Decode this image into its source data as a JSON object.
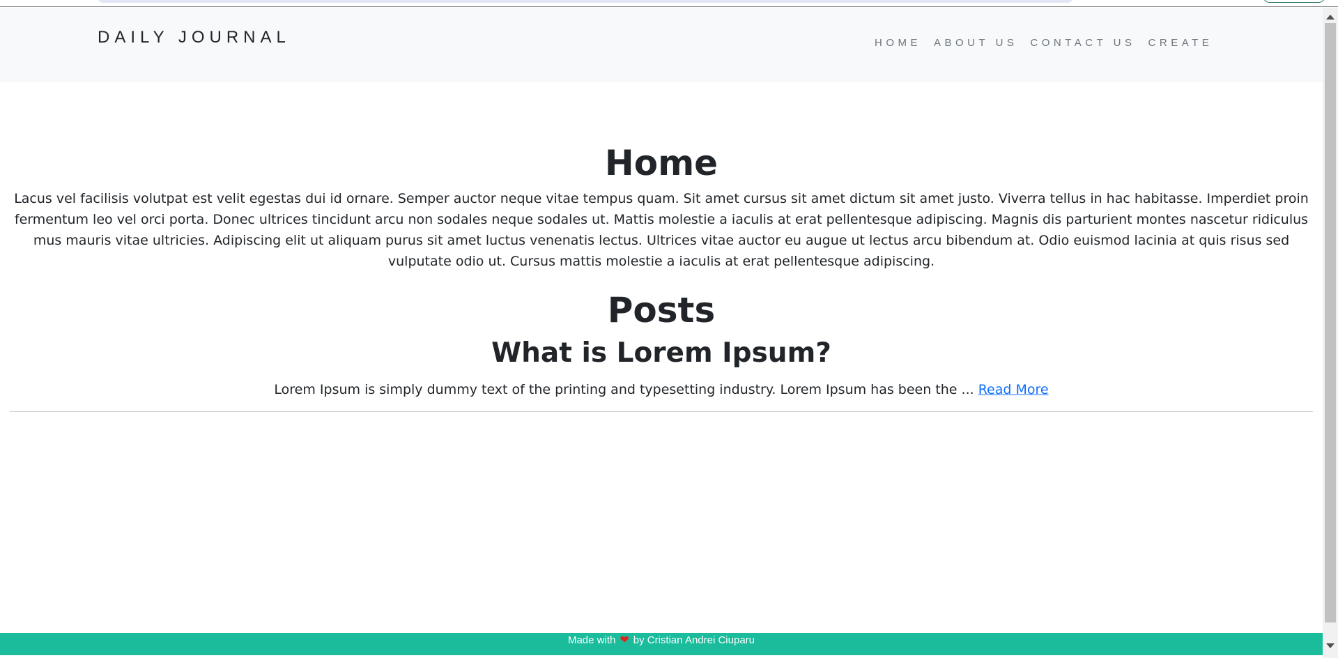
{
  "navbar": {
    "brand": "DAILY JOURNAL",
    "links": [
      {
        "label": "HOME"
      },
      {
        "label": "ABOUT US"
      },
      {
        "label": "CONTACT US"
      },
      {
        "label": "CREATE"
      }
    ]
  },
  "home": {
    "title": "Home",
    "text": "Lacus vel facilisis volutpat est velit egestas dui id ornare. Semper auctor neque vitae tempus quam. Sit amet cursus sit amet dictum sit amet justo. Viverra tellus in hac habitasse. Imperdiet proin fermentum leo vel orci porta. Donec ultrices tincidunt arcu non sodales neque sodales ut. Mattis molestie a iaculis at erat pellentesque adipiscing. Magnis dis parturient montes nascetur ridiculus mus mauris vitae ultricies. Adipiscing elit ut aliquam purus sit amet luctus venenatis lectus. Ultrices vitae auctor eu augue ut lectus arcu bibendum at. Odio euismod lacinia at quis risus sed vulputate odio ut. Cursus mattis molestie a iaculis at erat pellentesque adipiscing."
  },
  "posts": {
    "title": "Posts",
    "items": [
      {
        "title": "What is Lorem Ipsum?",
        "excerpt": "Lorem Ipsum is simply dummy text of the printing and typesetting industry. Lorem Ipsum has been the ...",
        "read_more": "Read More"
      }
    ]
  },
  "footer": {
    "made_with": "Made with",
    "heart_icon": "heart-icon",
    "by": "by Cristian Andrei Ciuparu"
  },
  "colors": {
    "navbar_bg": "#f8f9fa",
    "footer_bg": "#1abc9c",
    "link": "#0d6efd",
    "heart": "#e0241a"
  }
}
